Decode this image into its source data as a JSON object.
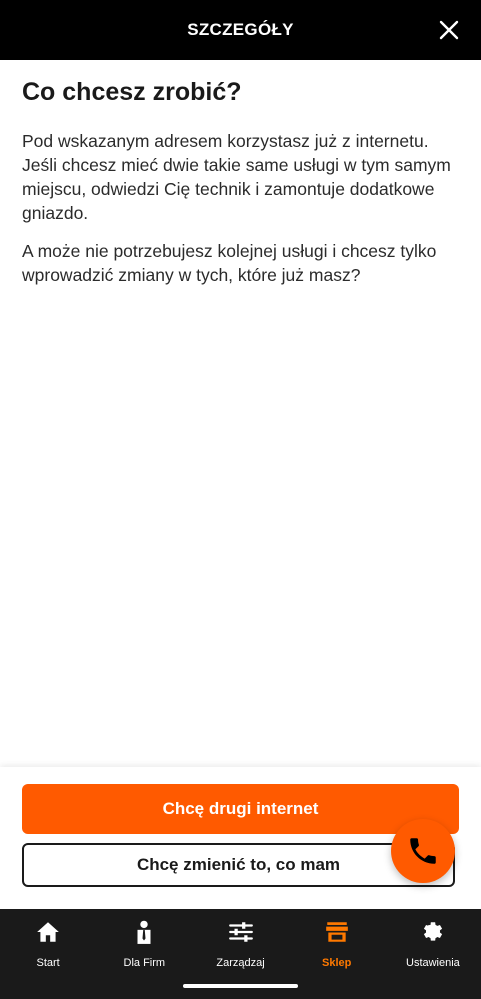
{
  "header": {
    "title": "SZCZEGÓŁY",
    "close_icon": "close-icon"
  },
  "content": {
    "heading": "Co chcesz zrobić?",
    "paragraph1": "Pod wskazanym adresem korzystasz już z internetu. Jeśli chcesz mieć dwie takie same usługi w tym samym miejscu, odwiedzi Cię technik i zamontuje dodatkowe gniazdo.",
    "paragraph2": "A może nie potrzebujesz kolejnej usługi i chcesz tylko wprowadzić zmiany w tych, które już masz?"
  },
  "actions": {
    "primary_label": "Chcę drugi internet",
    "secondary_label": "Chcę zmienić to, co mam"
  },
  "fab": {
    "icon": "phone-icon"
  },
  "tabbar": {
    "items": [
      {
        "label": "Start",
        "icon": "home-icon",
        "active": false
      },
      {
        "label": "Dla Firm",
        "icon": "business-person-icon",
        "active": false
      },
      {
        "label": "Zarządzaj",
        "icon": "sliders-icon",
        "active": false
      },
      {
        "label": "Sklep",
        "icon": "shop-icon",
        "active": true
      },
      {
        "label": "Ustawienia",
        "icon": "gear-icon",
        "active": false
      }
    ]
  },
  "colors": {
    "accent": "#ff5a00",
    "active_tab": "#ff7900",
    "header_bg": "#000000",
    "tabbar_bg": "#1a1a1a"
  }
}
